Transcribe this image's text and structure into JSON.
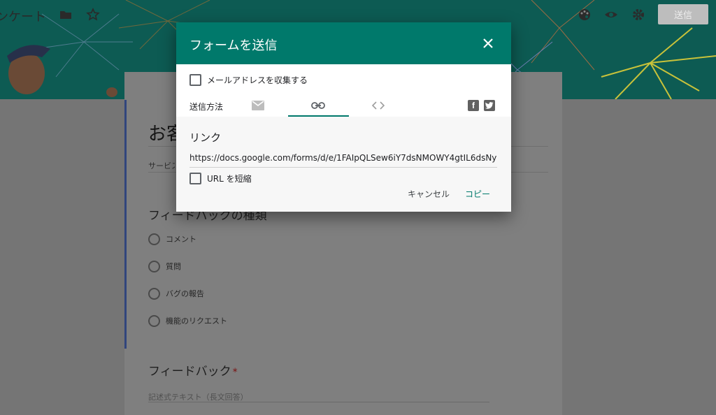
{
  "toolbar": {
    "form_title": "ンケート",
    "send_label": "送信",
    "icons": [
      "folder-icon",
      "star-icon",
      "palette-icon",
      "eye-icon",
      "gear-icon"
    ]
  },
  "form": {
    "title_partial": "お客",
    "description_partial": "サービス",
    "question1": {
      "title": "フィードバックの種類",
      "options": [
        "コメント",
        "質問",
        "バグの報告",
        "機能のリクエスト"
      ]
    },
    "question2": {
      "title": "フィードバック",
      "required_mark": "*",
      "placeholder": "記述式テキスト（長文回答）"
    }
  },
  "dialog": {
    "title": "フォームを送信",
    "collect_email_label": "メールアドレスを収集する",
    "send_method_label": "送信方法",
    "tabs": [
      "email-icon",
      "link-icon",
      "embed-icon"
    ],
    "active_tab": "link",
    "social": [
      "facebook-icon",
      "twitter-icon"
    ],
    "link_panel": {
      "title": "リンク",
      "url": "https://docs.google.com/forms/d/e/1FAIpQLSew6iY7dsNMOWY4gtIL6dsNy",
      "shorten_label": "URL を短縮",
      "cancel_label": "キャンセル",
      "copy_label": "コピー"
    }
  },
  "colors": {
    "accent": "#00796b",
    "header_bg": "#0c5a52"
  }
}
